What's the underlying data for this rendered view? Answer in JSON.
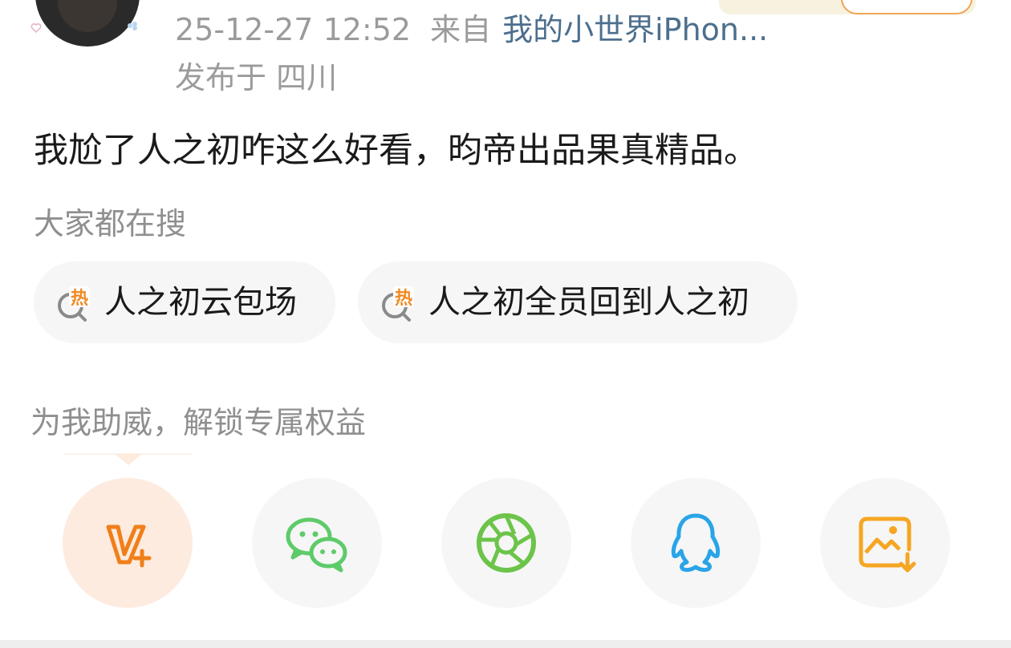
{
  "post": {
    "timestamp": "25-12-27 12:52",
    "from_label": "来自",
    "source": "我的小世界iPhon...",
    "location": "发布于 四川",
    "text": "我尬了人之初咋这么好看，昀帝出品果真精品。"
  },
  "trending": {
    "label": "大家都在搜",
    "hot_badge": "热",
    "items": [
      {
        "label": "人之初云包场"
      },
      {
        "label": "人之初全员回到人之初"
      }
    ]
  },
  "support": {
    "text": "为我助威，解锁专属权益"
  },
  "share": {
    "buttons": [
      {
        "icon": "vplus-icon",
        "action": "support"
      },
      {
        "icon": "wechat-icon",
        "action": "share-wechat"
      },
      {
        "icon": "moments-icon",
        "action": "share-moments"
      },
      {
        "icon": "qq-icon",
        "action": "share-qq"
      },
      {
        "icon": "save-image-icon",
        "action": "save-image"
      }
    ]
  },
  "colors": {
    "meta_gray": "#9b9b9b",
    "source_link": "#4d6f8e",
    "hot_orange": "#f08a24",
    "vplus_orange": "#f07f1a",
    "wechat_green": "#5ecb6a",
    "moments_green": "#6cc44a",
    "qq_blue": "#2aa4e8",
    "save_orange": "#f5a623",
    "chip_bg": "#f6f6f6"
  }
}
